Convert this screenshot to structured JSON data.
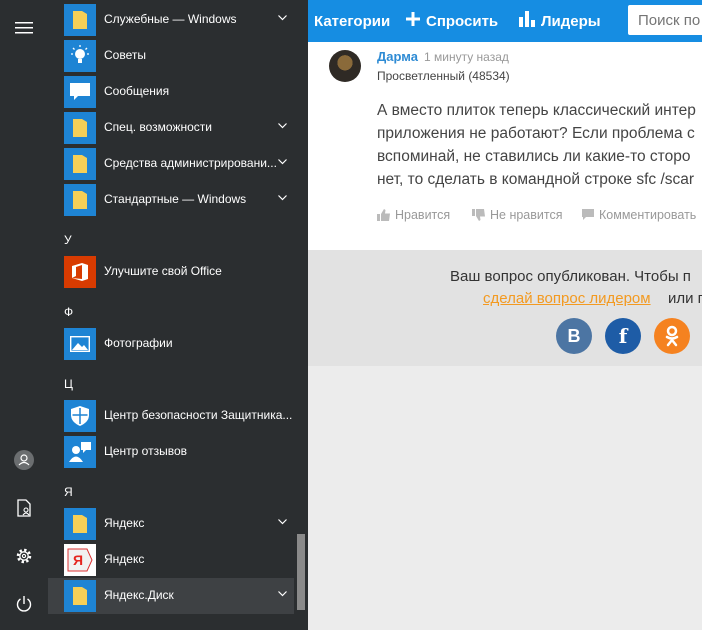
{
  "site": {
    "nav": {
      "categories": "Категории",
      "ask": "Спросить",
      "leaders": "Лидеры",
      "search_placeholder": "Поиск по"
    },
    "answer": {
      "author": "Дарма",
      "time": "1 минуту назад",
      "rank": "Просветленный (48534)",
      "lines": [
        "А вместо плиток теперь классический интер",
        "приложения не работают? Если проблема с",
        "вспоминай, не ставились ли какие-то сторо",
        "нет, то сделать в командной строке sfc /scar"
      ],
      "like": "Нравится",
      "dislike": "Не нравится",
      "comment": "Комментировать"
    },
    "published": {
      "text": "Ваш вопрос опубликован. Чтобы п",
      "link": "сделай вопрос лидером",
      "or": "или п"
    },
    "social": {
      "vk": "В",
      "fb": "f",
      "ok": "ок"
    }
  },
  "start_menu": {
    "apps": [
      {
        "label": "Служебные — Windows",
        "icon": "folder-icon",
        "expandable": true
      },
      {
        "label": "Советы",
        "icon": "lightbulb-icon",
        "expandable": false
      },
      {
        "label": "Сообщения",
        "icon": "message-icon",
        "expandable": false
      },
      {
        "label": "Спец. возможности",
        "icon": "folder-icon",
        "expandable": true
      },
      {
        "label": "Средства администрировани...",
        "icon": "folder-icon",
        "expandable": true
      },
      {
        "label": "Стандартные — Windows",
        "icon": "folder-icon",
        "expandable": true
      },
      {
        "label": "Улучшите свой Office",
        "icon": "office-icon",
        "expandable": false
      },
      {
        "label": "Фотографии",
        "icon": "photos-icon",
        "expandable": false
      },
      {
        "label": "Центр безопасности Защитника...",
        "icon": "shield-icon",
        "expandable": false
      },
      {
        "label": "Центр отзывов",
        "icon": "feedback-icon",
        "expandable": false
      },
      {
        "label": "Яндекс",
        "icon": "folder-icon",
        "expandable": true
      },
      {
        "label": "Яндекс",
        "icon": "yandex-browser-icon",
        "expandable": false
      },
      {
        "label": "Яндекс.Диск",
        "icon": "folder-icon",
        "expandable": true
      }
    ],
    "letters": [
      "У",
      "Ф",
      "Ц",
      "Я"
    ],
    "colors": {
      "menu_bg": "#2b2e30",
      "tile_blue": "#1e84d4",
      "office_red": "#d83b01",
      "site_blue": "#168de2"
    }
  }
}
